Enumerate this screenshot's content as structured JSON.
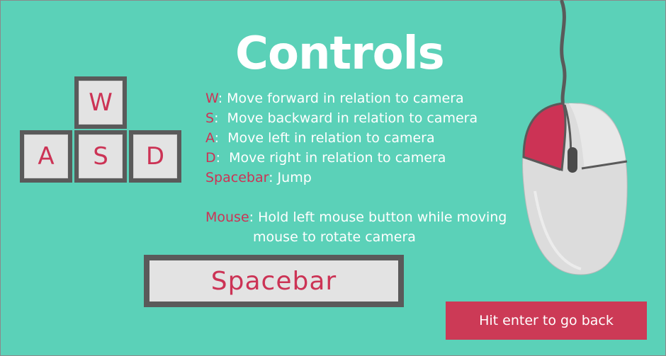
{
  "screen": {
    "title": "Controls"
  },
  "keys": {
    "w": "W",
    "a": "A",
    "s": "S",
    "d": "D",
    "space": "Spacebar"
  },
  "controls": [
    {
      "key": "W",
      "sep": ": ",
      "desc": "Move forward in relation to camera"
    },
    {
      "key": "S",
      "sep": ":  ",
      "desc": "Move backward in relation to camera"
    },
    {
      "key": "A",
      "sep": ":  ",
      "desc": "Move left in relation to camera"
    },
    {
      "key": "D",
      "sep": ":  ",
      "desc": "Move right in relation to camera"
    },
    {
      "key": "Spacebar",
      "sep": ": ",
      "desc": "Jump"
    }
  ],
  "mouse_control": {
    "key": "Mouse",
    "sep": ": ",
    "line1": "Hold left mouse button while moving",
    "line2": "mouse to rotate camera"
  },
  "back_button": {
    "label": "Hit enter to go back"
  },
  "colors": {
    "background": "#5bd1b8",
    "accent": "#cc3355",
    "key_body": "#5a5a5a",
    "key_cap": "#e3e3e3"
  },
  "icons": [
    "wasd-keys-illustration",
    "spacebar-key-illustration",
    "mouse-icon"
  ]
}
